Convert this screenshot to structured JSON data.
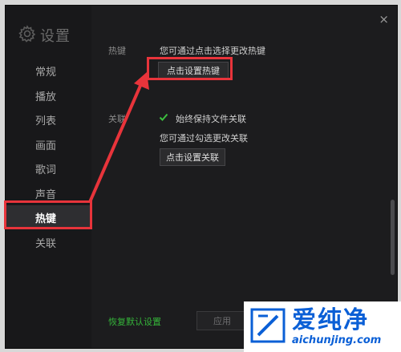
{
  "window": {
    "title": "设置",
    "close_symbol": "×"
  },
  "sidebar": {
    "items": [
      {
        "label": "常规",
        "active": false
      },
      {
        "label": "播放",
        "active": false
      },
      {
        "label": "列表",
        "active": false
      },
      {
        "label": "画面",
        "active": false
      },
      {
        "label": "歌词",
        "active": false
      },
      {
        "label": "声音",
        "active": false
      },
      {
        "label": "热键",
        "active": true
      },
      {
        "label": "关联",
        "active": false
      }
    ]
  },
  "hotkey": {
    "section_label": "热键",
    "description": "您可通过点击选择更改热键",
    "button_label": "点击设置热键"
  },
  "association": {
    "section_label": "关联",
    "checkbox_label": "始终保持文件关联",
    "checkbox_checked": true,
    "description": "您可通过勾选更改关联",
    "button_label": "点击设置关联"
  },
  "footer": {
    "reset_label": "恢复默认设置",
    "apply_label": "应用"
  },
  "colors": {
    "highlight": "#e8343b",
    "accent_green": "#35b53a",
    "watermark_blue": "#0a5fd6"
  },
  "watermark": {
    "brand": "爱纯净",
    "url": "aichunjing.com"
  }
}
